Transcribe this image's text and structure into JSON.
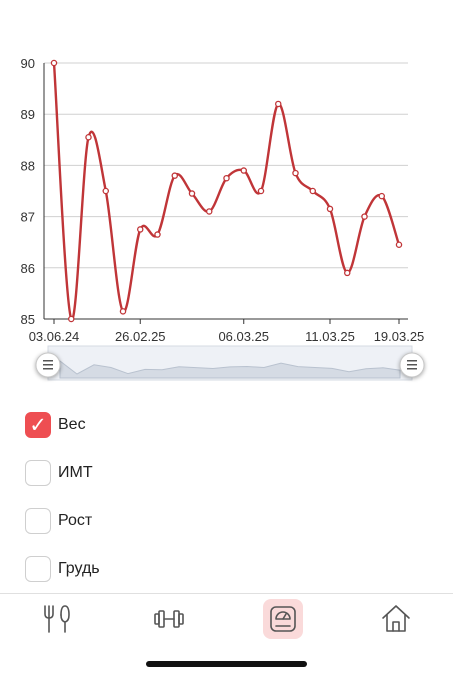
{
  "chart_data": {
    "type": "line",
    "x": [
      "03.06.24",
      "p2",
      "p3",
      "p4",
      "p5",
      "26.02.25",
      "p7",
      "p8",
      "p9",
      "p10",
      "p11",
      "06.03.25",
      "p13",
      "p14",
      "p15",
      "p16",
      "11.03.25",
      "p18",
      "p19",
      "p20",
      "19.03.25"
    ],
    "xtick_labels": [
      "03.06.24",
      "26.02.25",
      "06.03.25",
      "11.03.25",
      "19.03.25"
    ],
    "series": [
      {
        "values": [
          90.0,
          85.0,
          88.55,
          87.5,
          85.15,
          86.75,
          86.65,
          87.8,
          87.45,
          87.1,
          87.75,
          87.9,
          87.5,
          89.2,
          87.85,
          87.5,
          87.15,
          85.9,
          87.0,
          87.4,
          86.45
        ]
      }
    ],
    "ylim": [
      85,
      90
    ],
    "yticks": [
      85,
      86,
      87,
      88,
      89,
      90
    ],
    "grid": true,
    "line_color": "#c03538"
  },
  "checkboxes": [
    {
      "label": "Вес",
      "checked": true
    },
    {
      "label": "ИМТ",
      "checked": false
    },
    {
      "label": "Рост",
      "checked": false
    },
    {
      "label": "Грудь",
      "checked": false
    }
  ],
  "tabs": [
    {
      "icon": "fork-knife-icon",
      "active": false
    },
    {
      "icon": "dumbbell-icon",
      "active": false
    },
    {
      "icon": "scale-icon",
      "active": true
    },
    {
      "icon": "home-icon",
      "active": false
    }
  ],
  "colors": {
    "accent": "#ee4e52",
    "line": "#c03538",
    "grid": "#d0d0d0"
  }
}
